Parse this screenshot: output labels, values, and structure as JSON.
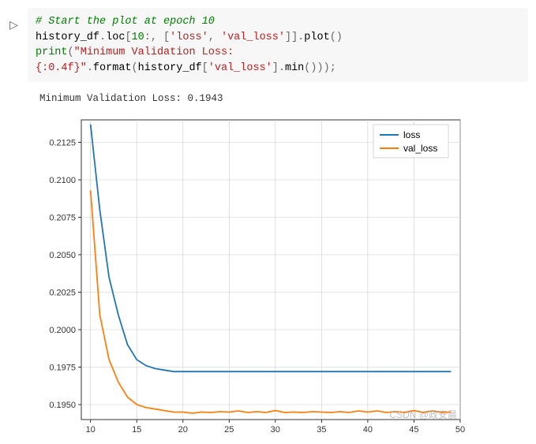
{
  "code": {
    "comment": "# Start the plot at epoch 10",
    "var1": "history_df",
    "attr_loc": "loc",
    "slice_start": "10",
    "col1": "'loss'",
    "col2": "'val_loss'",
    "attr_plot": "plot",
    "builtin_print": "print",
    "str_msg": "\"Minimum Validation Loss: {:0.4f}\"",
    "attr_format": "format",
    "var2": "history_df",
    "idx_col": "'val_loss'",
    "attr_min": "min"
  },
  "output_text": "Minimum Validation Loss: 0.1943",
  "chart_data": {
    "type": "line",
    "x": [
      10,
      11,
      12,
      13,
      14,
      15,
      16,
      17,
      18,
      19,
      20,
      25,
      30,
      35,
      40,
      45,
      49
    ],
    "series": [
      {
        "name": "loss",
        "color": "#1f77b4",
        "values": [
          0.2137,
          0.208,
          0.2035,
          0.201,
          0.199,
          0.198,
          0.1976,
          0.1974,
          0.1973,
          0.1972,
          0.1972,
          0.1972,
          0.1972,
          0.1972,
          0.1972,
          0.1972,
          0.1972
        ]
      },
      {
        "name": "val_loss",
        "color": "#ff7f0e",
        "values": [
          0.2093,
          0.201,
          0.198,
          0.1965,
          0.1955,
          0.195,
          0.1948,
          0.1947,
          0.1946,
          0.1945,
          0.1945,
          0.1945,
          0.1946,
          0.1945,
          0.1945,
          0.1946,
          0.1945
        ]
      }
    ],
    "yticks": [
      0.195,
      0.1975,
      0.2,
      0.2025,
      0.205,
      0.2075,
      0.21,
      0.2125
    ],
    "xticks": [
      10,
      15,
      20,
      25,
      30,
      35,
      40,
      45,
      50
    ],
    "xlim": [
      9,
      50
    ],
    "ylim": [
      0.194,
      0.214
    ]
  },
  "legend": {
    "item1": "loss",
    "item2": "val_loss"
  },
  "watermark": "CSDN @政安晨"
}
